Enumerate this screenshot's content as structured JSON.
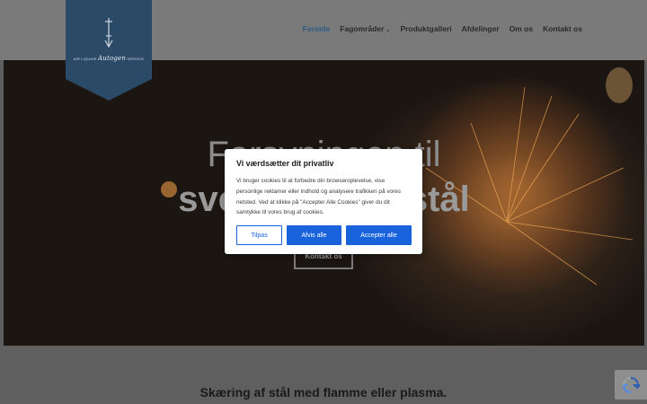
{
  "logo": {
    "left": "AIR LIQUIDE",
    "script": "Autogen",
    "right": "SERVICE"
  },
  "nav": {
    "items": [
      {
        "label": "Forside",
        "active": true
      },
      {
        "label": "Fagområder",
        "dropdown": true
      },
      {
        "label": "Produktgalleri"
      },
      {
        "label": "Afdelinger"
      },
      {
        "label": "Om os"
      },
      {
        "label": "Kontakt os"
      }
    ]
  },
  "hero": {
    "title_line1": "Forsyningen til",
    "title_line2": "svejsning og stål",
    "button": "Kontakt os"
  },
  "section": {
    "heading": "Skæring af stål med flamme eller plasma."
  },
  "cookie": {
    "title": "Vi værdsætter dit privatliv",
    "body": "Vi bruger cookies til at forbedre din browseroplevelse, vise personlige reklamer eller indhold og analysere trafikken på vores netsted. Ved at klikke på \"Accepter Alle Cookies\" giver du dit samtykke til vores brug af cookies.",
    "customize": "Tilpas",
    "reject": "Afvis alle",
    "accept": "Accepter alle"
  },
  "colors": {
    "accent": "#1863dc",
    "logo_bg": "#2d5a86",
    "nav_active": "#2c5a85"
  },
  "icons": {
    "recaptcha": "recaptcha-icon",
    "dropdown": "chevron-down-icon",
    "logo": "torch-icon"
  }
}
